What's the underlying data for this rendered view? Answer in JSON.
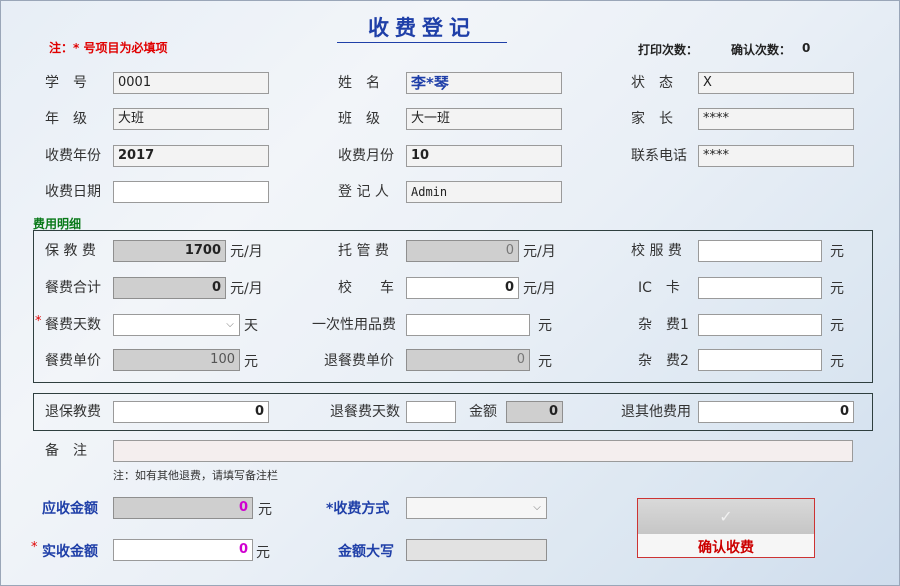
{
  "form": {
    "title": "收费登记",
    "note_required": "注：* 号项目为必填项",
    "print_count_label": "打印次数：",
    "print_count": "",
    "confirm_count_label": "确认次数：",
    "confirm_count": "0"
  },
  "basic": {
    "student_no": {
      "label": "学　号",
      "value": "0001"
    },
    "name": {
      "label": "姓　名",
      "value": "李*琴"
    },
    "status": {
      "label": "状　态",
      "value": "X"
    },
    "grade": {
      "label": "年　级",
      "value": "大班"
    },
    "class": {
      "label": "班　级",
      "value": "大一班"
    },
    "parent": {
      "label": "家　长",
      "value": "****"
    },
    "fee_year": {
      "label": "收费年份",
      "value": "2017"
    },
    "fee_month": {
      "label": "收费月份",
      "value": "10"
    },
    "phone": {
      "label": "联系电话",
      "value": "****"
    },
    "fee_date": {
      "label": "收费日期",
      "value": ""
    },
    "registrar": {
      "label": "登 记 人",
      "value": "Admin"
    }
  },
  "detail": {
    "section_label": "费用明细",
    "care_fee": {
      "label": "保 教 费",
      "value": "1700",
      "unit": "元/月"
    },
    "custody_fee": {
      "label": "托 管 费",
      "value": "0",
      "unit": "元/月"
    },
    "uniform_fee": {
      "label": "校 服 费",
      "value": "",
      "unit": "元"
    },
    "meal_total": {
      "label": "餐费合计",
      "value": "0",
      "unit": "元/月"
    },
    "bus": {
      "label": "校　　车",
      "value": "0",
      "unit": "元/月"
    },
    "ic_card": {
      "label": "IC　卡",
      "value": "",
      "unit": "元"
    },
    "meal_days": {
      "label": "餐费天数",
      "value": "",
      "unit": "天"
    },
    "disposables": {
      "label": "一次性用品费",
      "value": "",
      "unit": "元"
    },
    "misc1": {
      "label": "杂　费1",
      "value": "",
      "unit": "元"
    },
    "meal_price": {
      "label": "餐费单价",
      "value": "100",
      "unit": "元"
    },
    "refund_meal_price": {
      "label": "退餐费单价",
      "value": "0",
      "unit": "元"
    },
    "misc2": {
      "label": "杂　费2",
      "value": "",
      "unit": "元"
    }
  },
  "refund": {
    "care": {
      "label": "退保教费",
      "value": "0"
    },
    "meal_days": {
      "label": "退餐费天数",
      "value": ""
    },
    "amount": {
      "label": "金额",
      "value": "0"
    },
    "other": {
      "label": "退其他费用",
      "value": "0"
    }
  },
  "remarks": {
    "label": "备　注",
    "value": "",
    "hint": "注：如有其他退费，请填写备注栏"
  },
  "payment": {
    "receivable": {
      "label": "应收金额",
      "value": "0",
      "unit": "元"
    },
    "method": {
      "label": "*收费方式",
      "value": ""
    },
    "actual": {
      "label": "实收金额",
      "value": "0",
      "unit": "元"
    },
    "amount_upper": {
      "label": "金额大写",
      "value": ""
    },
    "confirm_button": "确认收费",
    "confirm_icon": "checkmark-icon"
  },
  "colors": {
    "title": "#1f3fa8",
    "section": "#0a7a1a",
    "required": "#e00000",
    "payment_label": "#1f3fa8",
    "amount_value": "#d000d0",
    "button_text": "#cc0000"
  }
}
